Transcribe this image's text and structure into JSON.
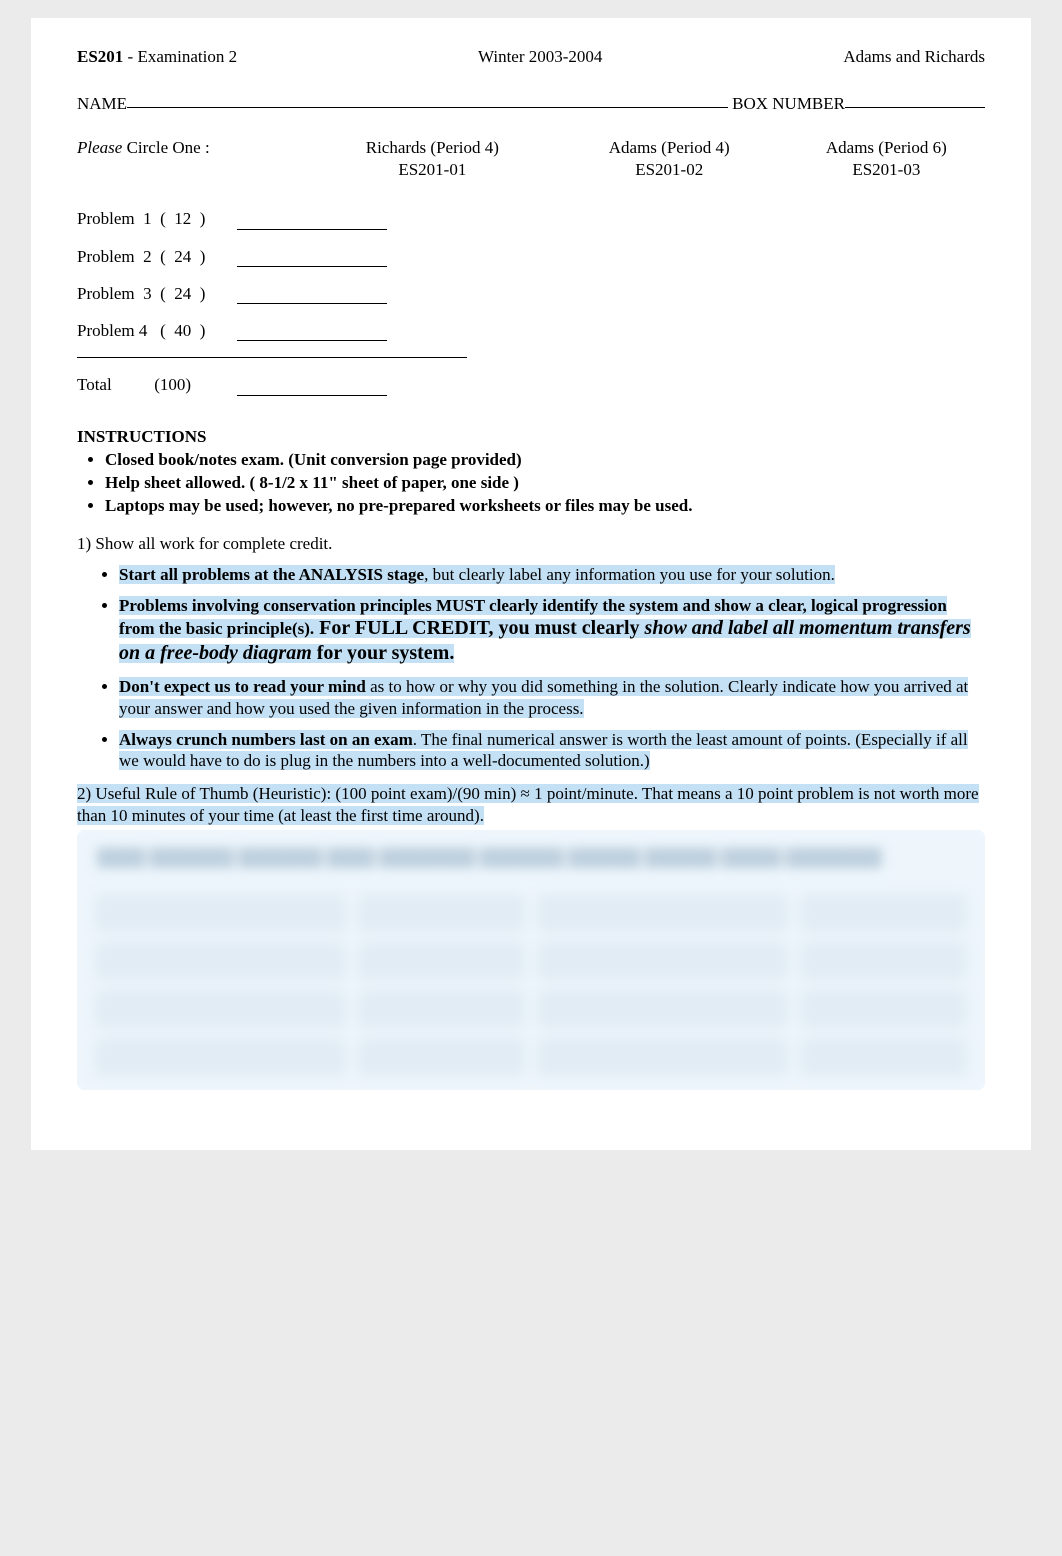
{
  "header": {
    "left": "ES201 - Examination 2",
    "center": "Winter 2003-2004",
    "right": "Adams and Richards",
    "left_strong_part": "ES201",
    "left_rest": " - Examination 2"
  },
  "name_line": {
    "name_label": "NAME",
    "box_label": "BOX NUMBER"
  },
  "circle": {
    "please_italic": "Please",
    "circle_rest": " Circle One :",
    "opt1_line1": "Richards (Period 4)",
    "opt1_line2": "ES201-01",
    "opt2_line1": "Adams (Period 4)",
    "opt2_line2": "ES201-02",
    "opt3_line1": "Adams (Period 6)",
    "opt3_line2": "ES201-03"
  },
  "problems": {
    "p1": "Problem  1  (  12  )",
    "p2": "Problem  2  (  24  )",
    "p3": "Problem  3  (  24  )",
    "p4": "Problem 4   (  40  )",
    "total": "Total          (100)"
  },
  "instructions": {
    "heading": "INSTRUCTIONS",
    "b1": "Closed book/notes exam.   (Unit conversion page provided)",
    "b2": "Help sheet allowed. ( 8-1/2 x 11\" sheet of paper, one side )",
    "b3": "Laptops may be used; however, no pre-prepared worksheets or files may be used."
  },
  "showwork": {
    "lead": "1)  Show all work for complete credit.",
    "s1_a": "Start all problems at the ANALYSIS stage",
    "s1_b": ", but clearly label any information you use for your solution.",
    "s2_a": "Problems involving conservation principles MUST clearly identify the system and show a clear, logical progression from the basic principle(s).",
    "s2_b": "  For FULL CREDIT, you must clearly ",
    "s2_c": "show and label all momentum transfers on a free-body diagram",
    "s2_d": " for your system.",
    "s3_a": "Don't expect us to read your mind",
    "s3_b": " as to how or why you did something in the solution.  Clearly indicate how you arrived at your answer and how you used the given information in the process.",
    "s4_a": "Always crunch numbers last on an exam",
    "s4_b": ". The final numerical answer is worth the least amount of points.  (Especially if all we would have to do is plug in the numbers into a well-documented solution.)"
  },
  "rule": {
    "text": "2)  Useful Rule of Thumb (Heuristic):  (100 point exam)/(90 min) ≈ 1 point/minute.  That means a 10 point problem is not worth more than 10 minutes of your time (at least the first time around)."
  }
}
